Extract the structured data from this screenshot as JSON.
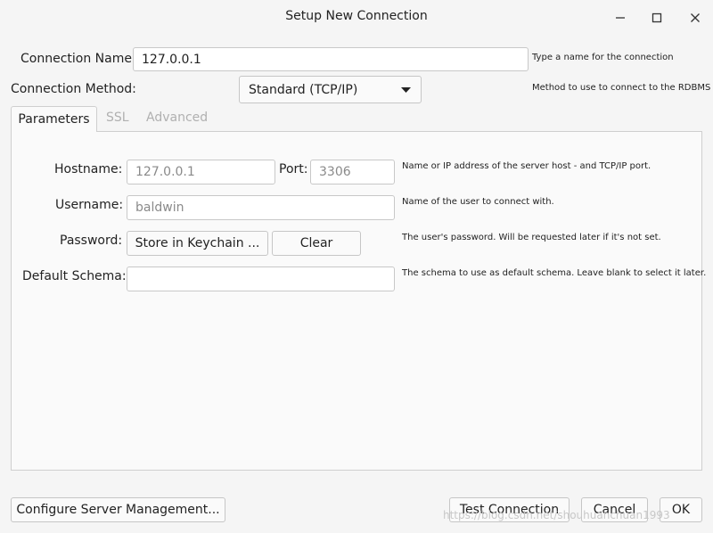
{
  "window": {
    "title": "Setup New Connection",
    "minimize_icon": "minimize-icon",
    "maximize_icon": "maximize-icon",
    "close_icon": "close-icon"
  },
  "connection": {
    "name_label": "Connection Name:",
    "name_value": "127.0.0.1",
    "name_hint": "Type a name for the connection",
    "method_label": "Connection Method:",
    "method_value": "Standard (TCP/IP)",
    "method_hint": "Method to use to connect to the RDBMS"
  },
  "tabs": [
    {
      "label": "Parameters",
      "active": true
    },
    {
      "label": "SSL",
      "active": false
    },
    {
      "label": "Advanced",
      "active": false
    }
  ],
  "params": {
    "hostname_label": "Hostname:",
    "hostname_value": "127.0.0.1",
    "port_label": "Port:",
    "port_value": "3306",
    "hostname_hint": "Name or IP address of the server host - and TCP/IP port.",
    "username_label": "Username:",
    "username_value": "baldwin",
    "username_hint": "Name of the user to connect with.",
    "password_label": "Password:",
    "store_keychain_label": "Store in Keychain ...",
    "clear_label": "Clear",
    "password_hint": "The user's password. Will be requested later if it's not set.",
    "schema_label": "Default Schema:",
    "schema_value": "",
    "schema_hint": "The schema to use as default schema. Leave blank to select it later."
  },
  "footer": {
    "configure_label": "Configure Server Management...",
    "test_label": "Test Connection",
    "cancel_label": "Cancel",
    "ok_label": "OK",
    "watermark": "https://blog.csdn.net/shouhuanchuan1993"
  }
}
